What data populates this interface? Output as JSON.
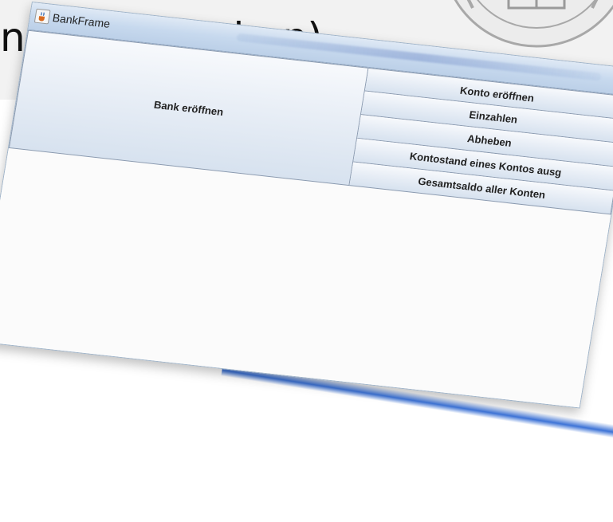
{
  "slide": {
    "title_fragment": "nutzereingaben)"
  },
  "window": {
    "title": "BankFrame",
    "icon": "java-cup-icon"
  },
  "buttons": {
    "open_bank": "Bank eröffnen",
    "open_account": "Konto eröffnen",
    "deposit": "Einzahlen",
    "withdraw": "Abheben",
    "show_balance": "Kontostand eines Kontos ausg",
    "total_balance": "Gesamtsaldo aller Konten"
  },
  "colors": {
    "button_top": "#f7f9fc",
    "button_bottom": "#d7e2ef",
    "titlebar": "#c7d9ee",
    "taskbar_accent": "#2864d2"
  }
}
